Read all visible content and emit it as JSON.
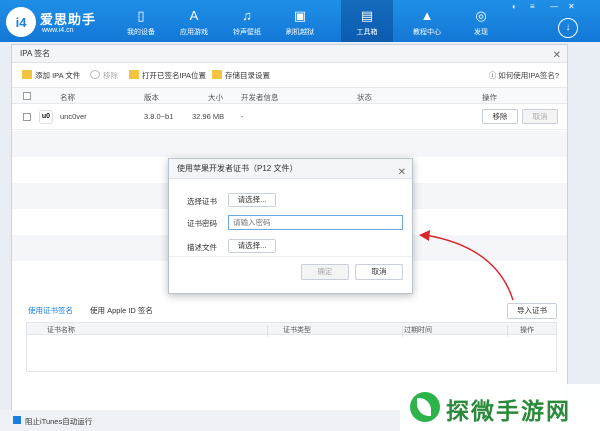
{
  "topbar": {
    "brand": "爱思助手",
    "url": "www.i4.cn",
    "nav": [
      {
        "label": "我的设备",
        "icon": "phone-icon"
      },
      {
        "label": "应用游戏",
        "icon": "appstore-icon"
      },
      {
        "label": "铃声壁纸",
        "icon": "music-icon"
      },
      {
        "label": "刷机越狱",
        "icon": "flash-icon"
      },
      {
        "label": "工具箱",
        "icon": "toolbox-icon"
      },
      {
        "label": "教程中心",
        "icon": "graduation-cap-icon"
      },
      {
        "label": "发现",
        "icon": "compass-icon"
      }
    ]
  },
  "window": {
    "title": "IPA 签名",
    "toolbar": {
      "add": "添加 IPA 文件",
      "remove": "移除",
      "open": "打开已签名IPA位置",
      "storage": "存储目录设置",
      "help": "如何使用IPA签名?"
    },
    "columns": [
      "名称",
      "版本",
      "大小",
      "开发者信息",
      "状态",
      "操作"
    ],
    "rows": [
      {
        "icon_text": "u0",
        "name": "unc0ver",
        "version": "3.8.0~b1",
        "size": "32.96 MB",
        "developer": "-",
        "remove": "移除",
        "cancel": "取消"
      }
    ],
    "cert_tabs": [
      "使用证书签名",
      "使用 Apple ID 签名"
    ],
    "import_cert": "导入证书",
    "cert_columns": [
      "证书名称",
      "证书类型",
      "过期时间",
      "操作"
    ]
  },
  "modal": {
    "title": "使用苹果开发者证书（P12 文件）",
    "select_cert_label": "选择证书",
    "select_btn": "请选择...",
    "password_label": "证书密码",
    "password_placeholder": "请输入密码",
    "profile_label": "描述文件",
    "profile_btn": "请选择...",
    "confirm": "确定",
    "cancel": "取消"
  },
  "footer": {
    "itunes": "阻止iTunes自动运行"
  },
  "watermark": "探微手游网"
}
